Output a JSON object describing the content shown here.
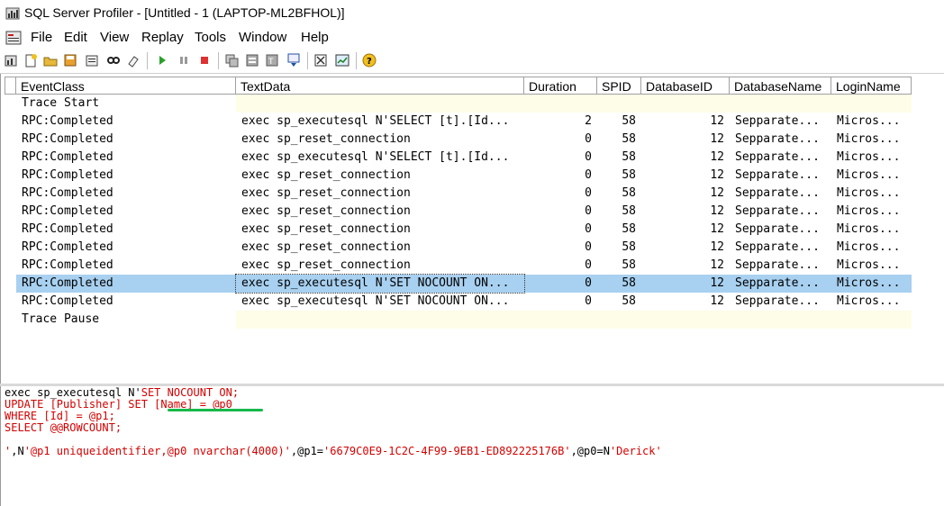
{
  "window": {
    "title": "SQL Server Profiler - [Untitled - 1 (LAPTOP-ML2BFHOL)]"
  },
  "menu": [
    "File",
    "Edit",
    "View",
    "Replay",
    "Tools",
    "Window",
    "Help"
  ],
  "toolbar": {
    "icons": [
      "new-trace-icon",
      "new-template-icon",
      "open-icon",
      "save-icon",
      "properties-icon",
      "find-icon",
      "clear-icon",
      "start-icon",
      "pause-icon",
      "stop-icon",
      "auto-scroll-icon",
      "scroll-icon",
      "text-icon",
      "filter-icon",
      "settings-icon",
      "chart-icon",
      "help-icon"
    ]
  },
  "grid": {
    "columns": [
      "EventClass",
      "TextData",
      "Duration",
      "SPID",
      "DatabaseID",
      "DatabaseName",
      "LoginName"
    ],
    "rows": [
      {
        "event": "Trace Start",
        "text": "",
        "duration": "",
        "spid": "",
        "dbid": "",
        "dbname": "",
        "login": ""
      },
      {
        "event": "RPC:Completed",
        "text": "exec sp_executesql N'SELECT [t].[Id...",
        "duration": "2",
        "spid": "58",
        "dbid": "12",
        "dbname": "Sepparate...",
        "login": "Micros..."
      },
      {
        "event": "RPC:Completed",
        "text": "exec sp_reset_connection",
        "duration": "0",
        "spid": "58",
        "dbid": "12",
        "dbname": "Sepparate...",
        "login": "Micros..."
      },
      {
        "event": "RPC:Completed",
        "text": "exec sp_executesql N'SELECT [t].[Id...",
        "duration": "0",
        "spid": "58",
        "dbid": "12",
        "dbname": "Sepparate...",
        "login": "Micros..."
      },
      {
        "event": "RPC:Completed",
        "text": "exec sp_reset_connection",
        "duration": "0",
        "spid": "58",
        "dbid": "12",
        "dbname": "Sepparate...",
        "login": "Micros..."
      },
      {
        "event": "RPC:Completed",
        "text": "exec sp_reset_connection",
        "duration": "0",
        "spid": "58",
        "dbid": "12",
        "dbname": "Sepparate...",
        "login": "Micros..."
      },
      {
        "event": "RPC:Completed",
        "text": "exec sp_reset_connection",
        "duration": "0",
        "spid": "58",
        "dbid": "12",
        "dbname": "Sepparate...",
        "login": "Micros..."
      },
      {
        "event": "RPC:Completed",
        "text": "exec sp_reset_connection",
        "duration": "0",
        "spid": "58",
        "dbid": "12",
        "dbname": "Sepparate...",
        "login": "Micros..."
      },
      {
        "event": "RPC:Completed",
        "text": "exec sp_reset_connection",
        "duration": "0",
        "spid": "58",
        "dbid": "12",
        "dbname": "Sepparate...",
        "login": "Micros..."
      },
      {
        "event": "RPC:Completed",
        "text": "exec sp_reset_connection",
        "duration": "0",
        "spid": "58",
        "dbid": "12",
        "dbname": "Sepparate...",
        "login": "Micros..."
      },
      {
        "event": "RPC:Completed",
        "text": "exec sp_executesql N'SET NOCOUNT ON...",
        "duration": "0",
        "spid": "58",
        "dbid": "12",
        "dbname": "Sepparate...",
        "login": "Micros...",
        "selected": true
      },
      {
        "event": "RPC:Completed",
        "text": "exec sp_executesql N'SET NOCOUNT ON...",
        "duration": "0",
        "spid": "58",
        "dbid": "12",
        "dbname": "Sepparate...",
        "login": "Micros..."
      },
      {
        "event": "Trace Pause",
        "text": "",
        "duration": "",
        "spid": "",
        "dbid": "",
        "dbname": "",
        "login": ""
      }
    ]
  },
  "detail": {
    "line1_kw": "exec sp_executesql N'",
    "line1_rest": "SET NOCOUNT ON;",
    "line2": "UPDATE [Publisher] SET [Name] = @p0",
    "line3": "WHERE [Id] = @p1;",
    "line4": "SELECT @@ROWCOUNT;",
    "line6_a": "'",
    "line6_b": ",N",
    "line6_c": "'@p1 uniqueidentifier,@p0 nvarchar(4000)'",
    "line6_d": ",@p1=",
    "line6_e": "'6679C0E9-1C2C-4F99-9EB1-ED892225176B'",
    "line6_f": ",@p0=N",
    "line6_g": "'Derick'"
  },
  "colors": {
    "selected_row": "#a8d0f0",
    "empty_cell": "#fdfde8",
    "text_red": "#d40000",
    "highlight_green": "#17b84a"
  }
}
